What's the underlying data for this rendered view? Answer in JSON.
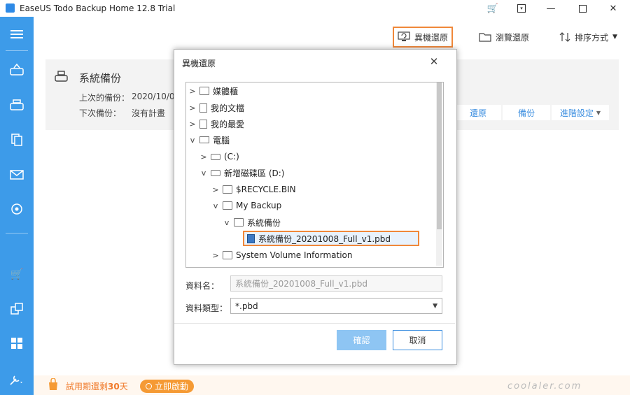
{
  "window": {
    "title": "EaseUS Todo Backup Home 12.8 Trial",
    "controls": [
      "cart-icon",
      "menu-icon",
      "minimize-icon",
      "maximize-icon",
      "close-icon"
    ]
  },
  "toolbar": {
    "alt_restore_label": "異機還原",
    "browse_restore_label": "瀏覽還原",
    "sort_label": "排序方式"
  },
  "backup_card": {
    "title": "系統備份",
    "last_backup_label": "上次的備份：",
    "last_backup_value": "2020/10/08",
    "next_backup_label": "下次備份：",
    "next_backup_value": "沒有計畫",
    "actions": {
      "restore": "還原",
      "backup": "備份",
      "advanced": "進階設定"
    }
  },
  "footer": {
    "trial_prefix": "試用期還剩",
    "trial_days": "30",
    "trial_suffix": "天",
    "activate_label": "立即啟動"
  },
  "dialog": {
    "title": "異機還原",
    "tree": [
      {
        "label": "媒體櫃",
        "icon": "folder-icon"
      },
      {
        "label": "我的文檔",
        "icon": "document-icon"
      },
      {
        "label": "我的最愛",
        "icon": "favorites-icon"
      },
      {
        "label": "電腦",
        "icon": "computer-icon"
      },
      {
        "label": "(C:)",
        "icon": "drive-icon"
      },
      {
        "label": "新增磁碟區 (D:)",
        "icon": "drive-icon"
      },
      {
        "label": "$RECYCLE.BIN",
        "icon": "folder-icon"
      },
      {
        "label": "My Backup",
        "icon": "folder-icon"
      },
      {
        "label": "系統備份",
        "icon": "folder-icon"
      },
      {
        "label": "系統備份_20201008_Full_v1.pbd",
        "icon": "backup-file-icon"
      },
      {
        "label": "System Volume Information",
        "icon": "folder-icon"
      }
    ],
    "filename_label": "資料名：",
    "filename_value": "系統備份_20201008_Full_v1.pbd",
    "filetype_label": "資料類型：",
    "filetype_value": "*.pbd",
    "ok_label": "確認",
    "cancel_label": "取消"
  },
  "watermark": "coolaler.com"
}
